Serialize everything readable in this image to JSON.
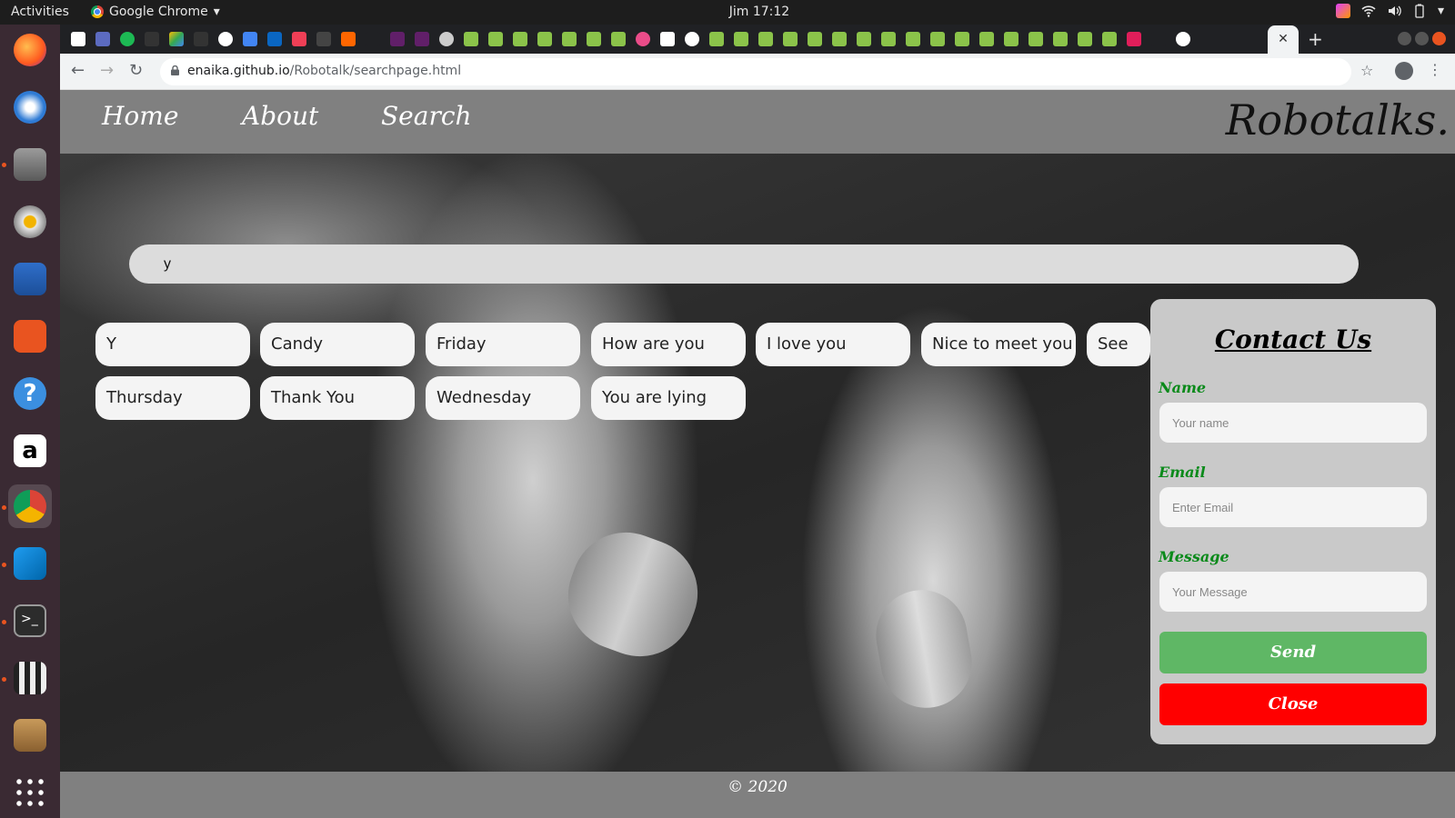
{
  "system": {
    "activities": "Activities",
    "app_name": "Google Chrome",
    "clock": "Jim 17:12"
  },
  "browser": {
    "url_host": "enaika.github.io",
    "url_path": "/Robotalk/searchpage.html",
    "active_tab_close": "✕",
    "new_tab": "+"
  },
  "nav": {
    "home": "Home",
    "about": "About",
    "search": "Search",
    "brand": "Robotalks."
  },
  "search": {
    "value": "y"
  },
  "chips": [
    "Y",
    "Candy",
    "Friday",
    "How are you",
    "I love you",
    "Nice to meet you",
    "See",
    "Thursday",
    "Thank You",
    "Wednesday",
    "You are lying"
  ],
  "contact": {
    "title": "Contact Us",
    "name_label": "Name",
    "name_placeholder": "Your name",
    "email_label": "Email",
    "email_placeholder": "Enter Email",
    "message_label": "Message",
    "message_placeholder": "Your Message",
    "send": "Send",
    "close": "Close",
    "send_color": "#5fb765",
    "close_color": "#ff0000"
  },
  "footer": "© 2020"
}
